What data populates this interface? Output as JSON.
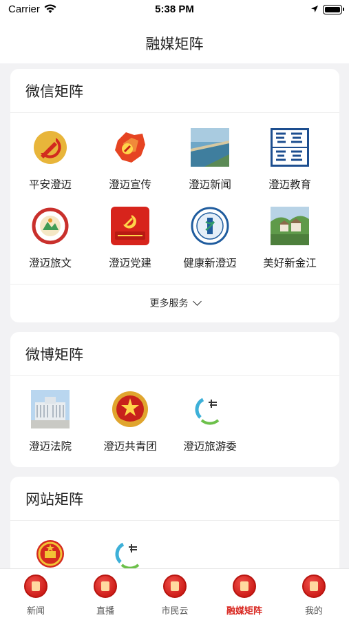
{
  "status": {
    "carrier": "Carrier",
    "time": "5:38 PM"
  },
  "nav": {
    "title": "融媒矩阵"
  },
  "wechat": {
    "title": "微信矩阵",
    "items": [
      {
        "label": "平安澄迈",
        "icon": "party-emblem-icon"
      },
      {
        "label": "澄迈宣传",
        "icon": "party-map-icon"
      },
      {
        "label": "澄迈新闻",
        "icon": "coast-photo-icon"
      },
      {
        "label": "澄迈教育",
        "icon": "education-calligraphy-icon"
      },
      {
        "label": "澄迈旅文",
        "icon": "tourism-seal-icon"
      },
      {
        "label": "澄迈党建",
        "icon": "party-building-icon"
      },
      {
        "label": "健康新澄迈",
        "icon": "health-seal-icon"
      },
      {
        "label": "美好新金江",
        "icon": "village-photo-icon"
      }
    ],
    "more_label": "更多服务"
  },
  "weibo": {
    "title": "微博矩阵",
    "items": [
      {
        "label": "澄迈法院",
        "icon": "court-building-icon"
      },
      {
        "label": "澄迈共青团",
        "icon": "youth-league-icon"
      },
      {
        "label": "澄迈旅游委",
        "icon": "tourism-logo-icon"
      }
    ]
  },
  "website": {
    "title": "网站矩阵",
    "items": [
      {
        "label": "",
        "icon": "national-emblem-icon"
      },
      {
        "label": "",
        "icon": "tourism-logo-icon"
      }
    ]
  },
  "tabs": [
    {
      "label": "新闻",
      "icon": "news-icon"
    },
    {
      "label": "直播",
      "icon": "live-icon"
    },
    {
      "label": "市民云",
      "icon": "citizen-cloud-icon"
    },
    {
      "label": "融媒矩阵",
      "icon": "media-matrix-icon",
      "active": true
    },
    {
      "label": "我的",
      "icon": "profile-icon"
    }
  ],
  "colors": {
    "accent": "#d8261f",
    "background": "#f2f2f4"
  }
}
